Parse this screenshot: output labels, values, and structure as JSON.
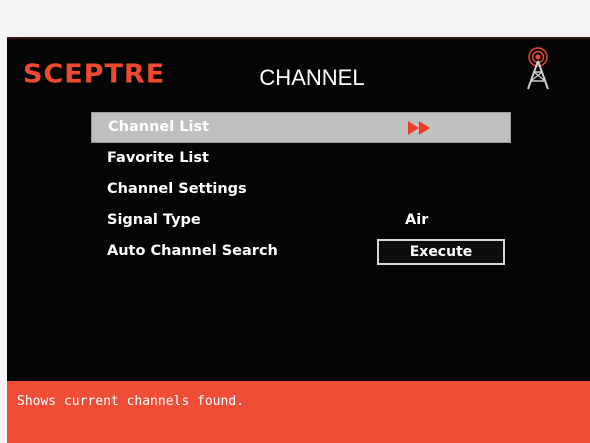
{
  "header": {
    "brand": "SCEPTRE",
    "title": "CHANNEL",
    "tower_icon": "antenna-tower-icon"
  },
  "menu": {
    "items": [
      {
        "label": "Channel List",
        "selected": true,
        "indicator_icon": "double-right-arrow-icon"
      },
      {
        "label": "Favorite List"
      },
      {
        "label": "Channel Settings"
      },
      {
        "label": "Signal Type",
        "value": "Air"
      },
      {
        "label": "Auto Channel Search",
        "button_label": "Execute"
      }
    ]
  },
  "help": {
    "text": "Shows current channels found."
  },
  "colors": {
    "accent": "#ef4a30",
    "selection": "#bfbfbf",
    "background": "#050505"
  }
}
